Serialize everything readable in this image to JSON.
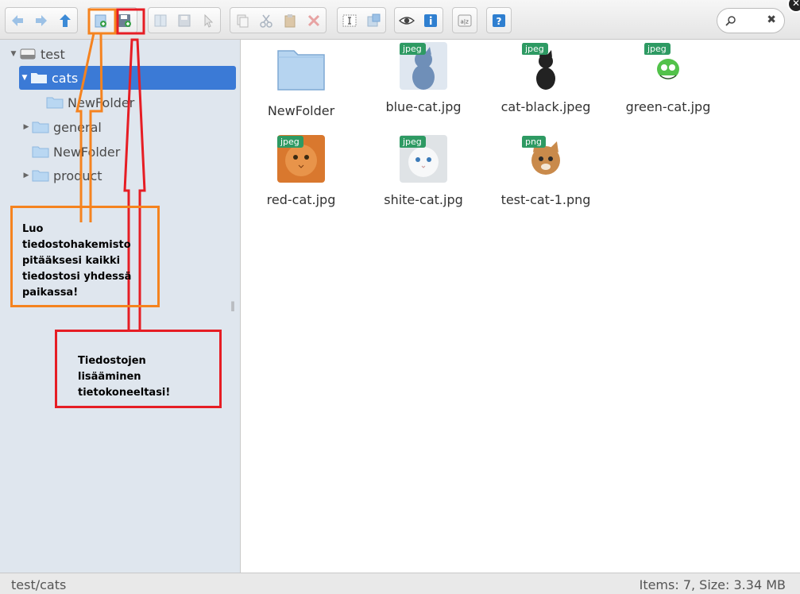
{
  "toolbar": {
    "groups": [
      {
        "name": "navigation",
        "buttons": [
          "back",
          "forward",
          "up"
        ]
      },
      {
        "name": "create",
        "buttons": [
          "new-folder",
          "upload"
        ]
      },
      {
        "name": "open",
        "buttons": [
          "open",
          "save",
          "select"
        ]
      },
      {
        "name": "edit",
        "buttons": [
          "copy",
          "cut",
          "paste",
          "delete"
        ]
      },
      {
        "name": "tools",
        "buttons": [
          "rename",
          "resize"
        ]
      },
      {
        "name": "view",
        "buttons": [
          "preview",
          "info"
        ]
      },
      {
        "name": "sort",
        "buttons": [
          "sort"
        ]
      },
      {
        "name": "help",
        "buttons": [
          "help"
        ]
      }
    ],
    "search": {
      "value": "",
      "clear_symbol": "✖"
    }
  },
  "sidebar": {
    "root": {
      "label": "test"
    },
    "items": [
      {
        "label": "cats",
        "selected": true,
        "expanded": true
      },
      {
        "label": "NewFolder",
        "child_of": "cats"
      },
      {
        "label": "general",
        "has_children": true
      },
      {
        "label": "NewFolder"
      },
      {
        "label": "product",
        "has_children": true
      }
    ]
  },
  "files": [
    {
      "name": "NewFolder",
      "type": "folder"
    },
    {
      "name": "blue-cat.jpg",
      "badge": "jpeg",
      "color": "#6f8fb8"
    },
    {
      "name": "cat-black.jpeg",
      "badge": "jpeg",
      "color": "#222222"
    },
    {
      "name": "green-cat.jpg",
      "badge": "jpeg",
      "color": "#52c24a"
    },
    {
      "name": "red-cat.jpg",
      "badge": "jpeg",
      "color": "#d9782e"
    },
    {
      "name": "shite-cat.jpg",
      "badge": "jpeg",
      "color": "#e8ecef"
    },
    {
      "name": "test-cat-1.png",
      "badge": "png",
      "color": "#c98a4b"
    }
  ],
  "status": {
    "path": "test/cats",
    "info": "Items: 7, Size: 3.34 MB"
  },
  "annotations": {
    "create_folder": {
      "text": "Luo tiedostohakemisto pitääksesi kaikki tiedostosi yhdessä paikassa!",
      "line1": "Luo tiedostohakemisto",
      "line2": "pitääksesi kaikki",
      "line3": "tiedostosi yhdessä",
      "line4": "paikassa!",
      "color": "#f5831f"
    },
    "upload": {
      "line1": "Tiedostojen lisääminen",
      "line2": "tietokoneeltasi!",
      "color": "#e61d24"
    }
  },
  "colors": {
    "selected": "#3b7ad6",
    "sidebar_bg": "#dfe6ee",
    "badge": "#2e9a63",
    "folder": "#a9cdef"
  }
}
